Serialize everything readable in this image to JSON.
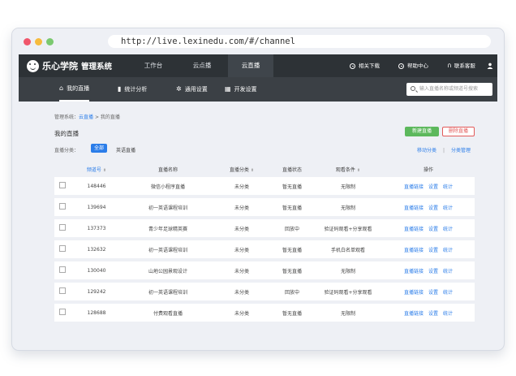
{
  "browser": {
    "url": "http://live.lexinedu.com/#/channel"
  },
  "app": {
    "logo_text": "乐心学院",
    "logo_sub": "管理系统"
  },
  "topnav": [
    {
      "label": "工作台"
    },
    {
      "label": "云点播"
    },
    {
      "label": "云直播"
    }
  ],
  "topright": {
    "downloads": "相关下载",
    "help": "帮助中心",
    "support": "联系客服"
  },
  "subnav": [
    {
      "label": "我的直播"
    },
    {
      "label": "统计分析"
    },
    {
      "label": "通用设置"
    },
    {
      "label": "开发设置"
    }
  ],
  "search": {
    "placeholder": "输入直播名称或频道号搜索"
  },
  "breadcrumb": {
    "root": "管理系统：",
    "live": "云直播",
    "sep": " > ",
    "current": "我的直播"
  },
  "page_title": "我的直播",
  "buttons": {
    "new_live": "新建直播",
    "delete_live": "删除直播"
  },
  "categories": {
    "label": "直播分类：",
    "all": "全部",
    "english": "英语直播"
  },
  "links": {
    "move": "移动分类",
    "manage": "分类管理",
    "sep": "|"
  },
  "table": {
    "headers": [
      "频道号",
      "直播名称",
      "直播分类",
      "直播状态",
      "观看条件",
      "操作"
    ],
    "sort_arrow": "⬍",
    "ops": [
      "直播链接",
      "设置",
      "统计"
    ],
    "rows": [
      {
        "id": "148446",
        "name": "微信小程序直播",
        "category": "未分类",
        "status": "暂无直播",
        "condition": "无限制"
      },
      {
        "id": "139694",
        "name": "初一英语课程培训",
        "category": "未分类",
        "status": "暂无直播",
        "condition": "无限制"
      },
      {
        "id": "137373",
        "name": "青少年足球精英赛",
        "category": "未分类",
        "status": "回放中",
        "condition": "验证码观看+分享观看"
      },
      {
        "id": "132632",
        "name": "初一英语课程培训",
        "category": "未分类",
        "status": "暂无直播",
        "condition": "手机白名单观看"
      },
      {
        "id": "130040",
        "name": "山地公园景观设计",
        "category": "未分类",
        "status": "暂无直播",
        "condition": "无限制"
      },
      {
        "id": "129242",
        "name": "初一英语课程培训",
        "category": "未分类",
        "status": "回放中",
        "condition": "验证码观看+分享观看"
      },
      {
        "id": "128688",
        "name": "付费观看直播",
        "category": "未分类",
        "status": "暂无直播",
        "condition": "无限制"
      }
    ]
  }
}
